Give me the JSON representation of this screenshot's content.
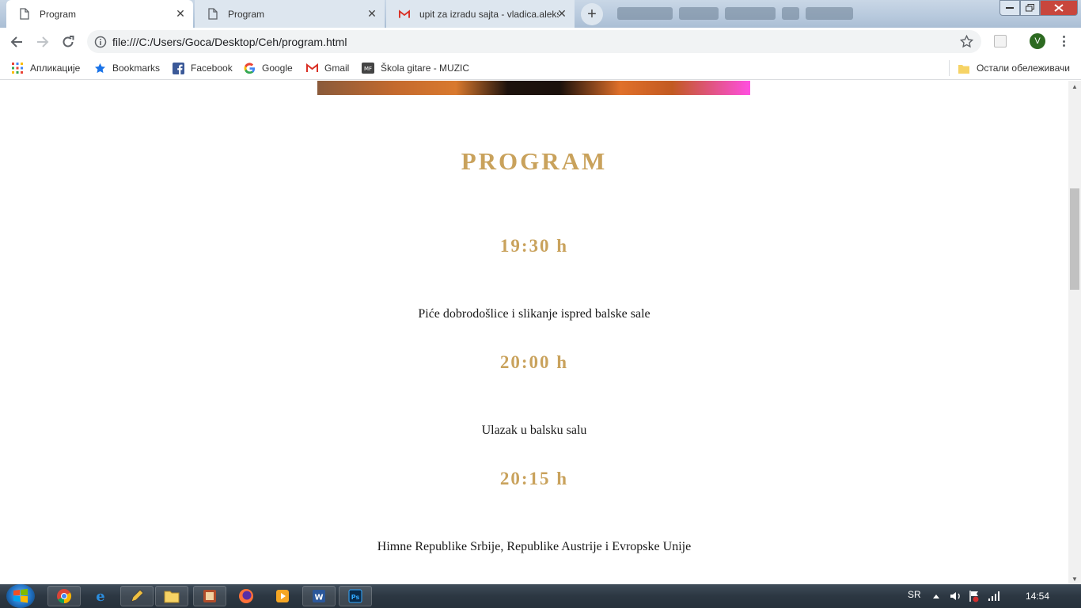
{
  "browser": {
    "tabs": [
      {
        "title": "Program",
        "active": true
      },
      {
        "title": "Program",
        "active": false
      },
      {
        "title": "upit za izradu sajta - vladica.aleks",
        "active": false
      }
    ],
    "new_tab_label": "+",
    "close_glyph": "✕",
    "address_url": "file:///C:/Users/Goca/Desktop/Ceh/program.html",
    "profile_initial": "V",
    "bookmarks": [
      {
        "label": "Апликације",
        "icon": "apps-grid-icon"
      },
      {
        "label": "Bookmarks",
        "icon": "star-icon"
      },
      {
        "label": "Facebook",
        "icon": "facebook-icon"
      },
      {
        "label": "Google",
        "icon": "google-icon"
      },
      {
        "label": "Gmail",
        "icon": "gmail-icon"
      },
      {
        "label": "Škola gitare - MUZIC",
        "icon": "mf-icon"
      }
    ],
    "other_bookmarks_label": "Остали обележивачи"
  },
  "page": {
    "title": "PROGRAM",
    "schedule": [
      {
        "time": "19:30 h",
        "description": "Piće dobrodošlice i slikanje ispred balske sale"
      },
      {
        "time": "20:00 h",
        "description": "Ulazak u balsku salu"
      },
      {
        "time": "20:15 h",
        "description": "Himne Republike Srbije, Republike Austrije i Evropske Unije"
      }
    ]
  },
  "taskbar": {
    "language": "SR",
    "clock": "14:54",
    "apps": [
      "chrome-icon",
      "internet-explorer-icon",
      "pencil-app-icon",
      "file-explorer-icon",
      "media-app-icon",
      "firefox-icon",
      "video-player-icon",
      "word-icon",
      "photoshop-icon"
    ]
  },
  "colors": {
    "heading_gold": "#c9a25c",
    "body_text": "#1a1a1a",
    "avatar_green": "#2d6a21"
  }
}
